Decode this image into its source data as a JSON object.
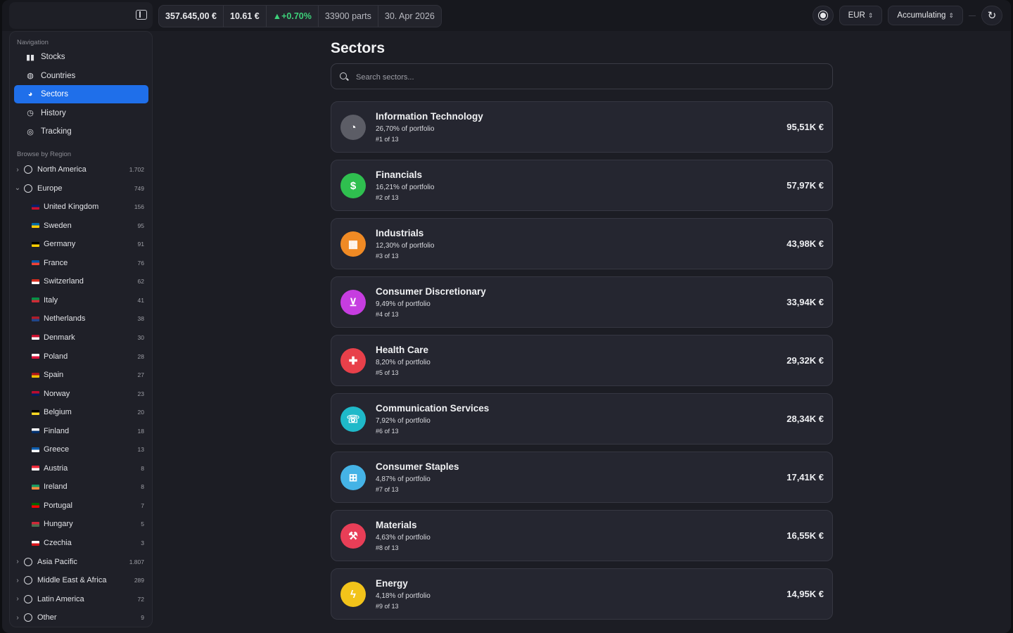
{
  "topbar": {
    "stats": {
      "total": "357.645,00 €",
      "price": "10.61 €",
      "change": "▲+0.70%",
      "parts": "33900 parts",
      "date": "30. Apr 2026"
    },
    "currency": "EUR",
    "mode": "Accumulating",
    "icons": [
      "sidebar-toggle-icon",
      "sun-icon",
      "refresh-icon"
    ]
  },
  "sidebar": {
    "nav_label": "Navigation",
    "nav_items": [
      {
        "label": "Stocks",
        "icon": "bar-chart-icon"
      },
      {
        "label": "Countries",
        "icon": "globe-icon"
      },
      {
        "label": "Sectors",
        "icon": "pie-chart-icon"
      },
      {
        "label": "History",
        "icon": "clock-icon"
      },
      {
        "label": "Tracking",
        "icon": "target-icon"
      }
    ],
    "active": "Sectors",
    "region_label": "Browse by Region",
    "regions_top": [
      {
        "name": "North America",
        "count": "1.702",
        "expanded": false
      },
      {
        "name": "Europe",
        "count": "749",
        "expanded": true
      }
    ],
    "countries": [
      {
        "name": "United Kingdom",
        "count": "156",
        "flag": [
          "#012169",
          "#c8102e"
        ]
      },
      {
        "name": "Sweden",
        "count": "95",
        "flag": [
          "#006aa7",
          "#fecc00"
        ]
      },
      {
        "name": "Germany",
        "count": "91",
        "flag": [
          "#000000",
          "#ffce00"
        ]
      },
      {
        "name": "France",
        "count": "76",
        "flag": [
          "#0055a4",
          "#ef4135"
        ]
      },
      {
        "name": "Switzerland",
        "count": "62",
        "flag": [
          "#d52b1e",
          "#ffffff"
        ]
      },
      {
        "name": "Italy",
        "count": "41",
        "flag": [
          "#009246",
          "#ce2b37"
        ]
      },
      {
        "name": "Netherlands",
        "count": "38",
        "flag": [
          "#ae1c28",
          "#21468b"
        ]
      },
      {
        "name": "Denmark",
        "count": "30",
        "flag": [
          "#c8102e",
          "#ffffff"
        ]
      },
      {
        "name": "Poland",
        "count": "28",
        "flag": [
          "#ffffff",
          "#dc143c"
        ]
      },
      {
        "name": "Spain",
        "count": "27",
        "flag": [
          "#aa151b",
          "#f1bf00"
        ]
      },
      {
        "name": "Norway",
        "count": "23",
        "flag": [
          "#ba0c2f",
          "#00205b"
        ]
      },
      {
        "name": "Belgium",
        "count": "20",
        "flag": [
          "#000000",
          "#fdda24"
        ]
      },
      {
        "name": "Finland",
        "count": "18",
        "flag": [
          "#ffffff",
          "#002f6c"
        ]
      },
      {
        "name": "Greece",
        "count": "13",
        "flag": [
          "#0d5eaf",
          "#ffffff"
        ]
      },
      {
        "name": "Austria",
        "count": "8",
        "flag": [
          "#ed2939",
          "#ffffff"
        ]
      },
      {
        "name": "Ireland",
        "count": "8",
        "flag": [
          "#169b62",
          "#ff883e"
        ]
      },
      {
        "name": "Portugal",
        "count": "7",
        "flag": [
          "#006600",
          "#ff0000"
        ]
      },
      {
        "name": "Hungary",
        "count": "5",
        "flag": [
          "#ce2939",
          "#477050"
        ]
      },
      {
        "name": "Czechia",
        "count": "3",
        "flag": [
          "#ffffff",
          "#d7141a"
        ]
      }
    ],
    "regions_bottom": [
      {
        "name": "Asia Pacific",
        "count": "1.807"
      },
      {
        "name": "Middle East & Africa",
        "count": "289"
      },
      {
        "name": "Latin America",
        "count": "72"
      },
      {
        "name": "Other",
        "count": "9"
      }
    ]
  },
  "main": {
    "title": "Sectors",
    "search_placeholder": "Search sectors...",
    "sectors": [
      {
        "name": "Information Technology",
        "pct": "26,70% of portfolio",
        "rank": "#1 of 13",
        "value": "95,51K €",
        "color": "#5c5d66",
        "icon": "pie-chart-icon",
        "glyph": "◔"
      },
      {
        "name": "Financials",
        "pct": "16,21% of portfolio",
        "rank": "#2 of 13",
        "value": "57,97K €",
        "color": "#2fbf4f",
        "icon": "dollar-icon",
        "glyph": "$"
      },
      {
        "name": "Industrials",
        "pct": "12,30% of portfolio",
        "rank": "#3 of 13",
        "value": "43,98K €",
        "color": "#f08a24",
        "icon": "building-icon",
        "glyph": "▦"
      },
      {
        "name": "Consumer Discretionary",
        "pct": "9,49% of portfolio",
        "rank": "#4 of 13",
        "value": "33,94K €",
        "color": "#c63de0",
        "icon": "cart-icon",
        "glyph": "⊻"
      },
      {
        "name": "Health Care",
        "pct": "8,20% of portfolio",
        "rank": "#5 of 13",
        "value": "29,32K €",
        "color": "#e8404a",
        "icon": "medkit-icon",
        "glyph": "✚"
      },
      {
        "name": "Communication Services",
        "pct": "7,92% of portfolio",
        "rank": "#6 of 13",
        "value": "28,34K €",
        "color": "#1fb9c9",
        "icon": "chat-icon",
        "glyph": "☏"
      },
      {
        "name": "Consumer Staples",
        "pct": "4,87% of portfolio",
        "rank": "#7 of 13",
        "value": "17,41K €",
        "color": "#45b3e6",
        "icon": "basket-icon",
        "glyph": "⊞"
      },
      {
        "name": "Materials",
        "pct": "4,63% of portfolio",
        "rank": "#8 of 13",
        "value": "16,55K €",
        "color": "#e83e57",
        "icon": "hammer-icon",
        "glyph": "⚒"
      },
      {
        "name": "Energy",
        "pct": "4,18% of portfolio",
        "rank": "#9 of 13",
        "value": "14,95K €",
        "color": "#f2c31a",
        "icon": "bolt-icon",
        "glyph": "ϟ"
      }
    ]
  }
}
